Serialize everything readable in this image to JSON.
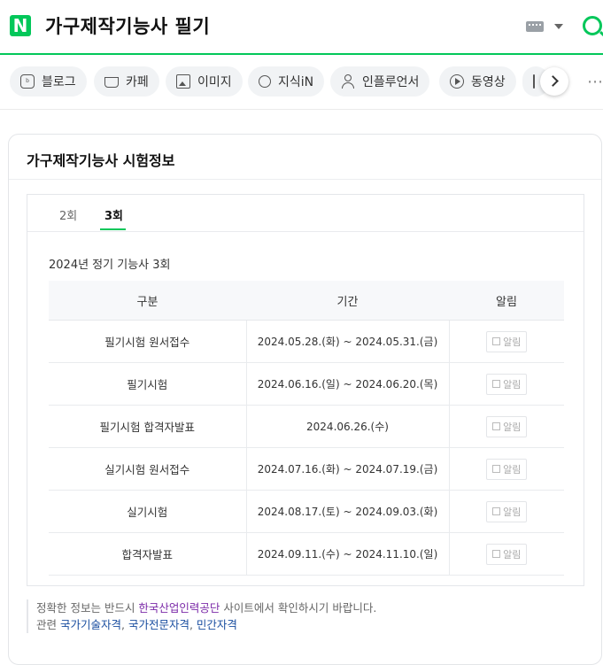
{
  "header": {
    "logo": "N",
    "query": "가구제작기능사 필기"
  },
  "tabs": [
    {
      "label": "블로그",
      "icon": "blog-icon"
    },
    {
      "label": "카페",
      "icon": "cafe-icon"
    },
    {
      "label": "이미지",
      "icon": "image-icon"
    },
    {
      "label": "지식iN",
      "icon": "question-icon"
    },
    {
      "label": "인플루언서",
      "icon": "person-icon"
    },
    {
      "label": "동영상",
      "icon": "play-icon"
    },
    {
      "label": "",
      "icon": "shopping-icon"
    }
  ],
  "card": {
    "title": "가구제작기능사 시험정보",
    "rounds": [
      "2회",
      "3회"
    ],
    "active_round": "3회",
    "subtitle": "2024년 정기 기능사 3회",
    "columns": [
      "구분",
      "기간",
      "알림"
    ],
    "rows": [
      {
        "name": "필기시험 원서접수",
        "period": "2024.05.28.(화) ~ 2024.05.31.(금)",
        "alarm": "알림"
      },
      {
        "name": "필기시험",
        "period": "2024.06.16.(일) ~ 2024.06.20.(목)",
        "alarm": "알림"
      },
      {
        "name": "필기시험 합격자발표",
        "period": "2024.06.26.(수)",
        "alarm": "알림"
      },
      {
        "name": "실기시험 원서접수",
        "period": "2024.07.16.(화) ~ 2024.07.19.(금)",
        "alarm": "알림"
      },
      {
        "name": "실기시험",
        "period": "2024.08.17.(토) ~ 2024.09.03.(화)",
        "alarm": "알림"
      },
      {
        "name": "합격자발표",
        "period": "2024.09.11.(수) ~ 2024.11.10.(일)",
        "alarm": "알림"
      }
    ]
  },
  "notice": {
    "line1_prefix": "정확한 정보는 반드시 ",
    "line1_link": "한국산업인력공단",
    "line1_suffix": " 사이트에서 확인하시기 바랍니다.",
    "line2_prefix": "관련 ",
    "links": [
      "국가기술자격",
      "국가전문자격",
      "민간자격"
    ]
  },
  "colors": {
    "brand": "#03c75a",
    "link_purple": "#7b2aa8",
    "link_blue": "#1a4ea0"
  }
}
